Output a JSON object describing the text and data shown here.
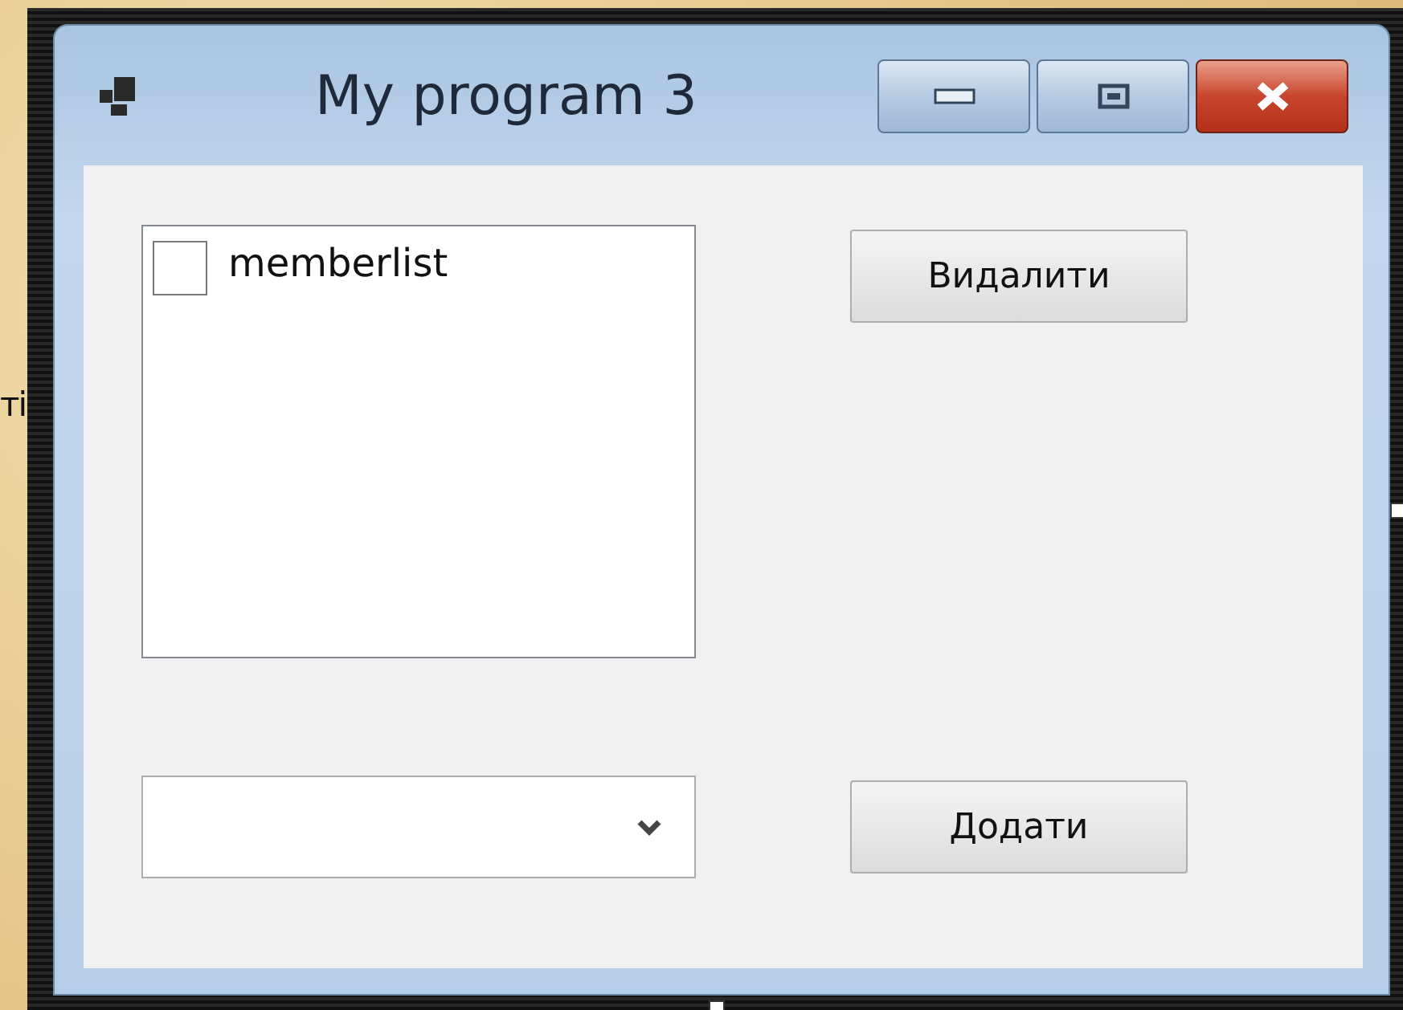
{
  "background_text": "ті",
  "window": {
    "title": "My program 3"
  },
  "checklist": {
    "items": [
      {
        "label": "memberlist",
        "checked": false
      }
    ]
  },
  "delete_button": {
    "label": "Видалити"
  },
  "dropdown": {
    "kind": "combobox"
  },
  "add_button": {
    "label": "Додати"
  }
}
